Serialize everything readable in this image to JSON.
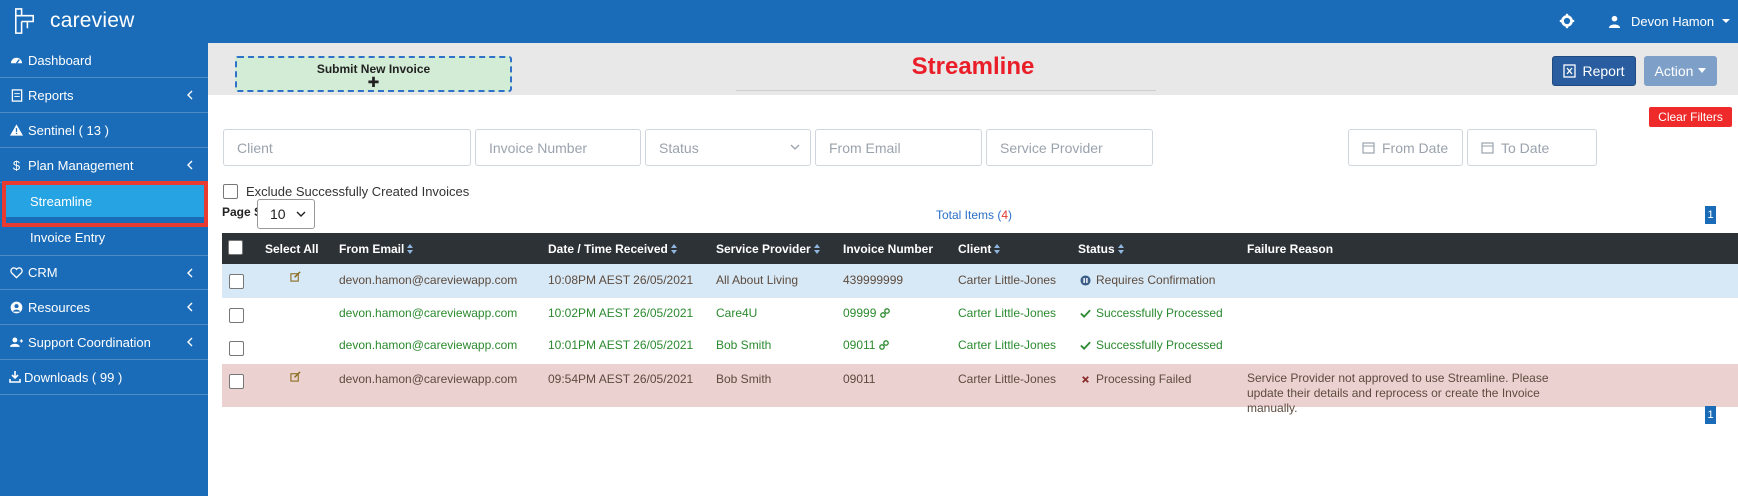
{
  "app": {
    "name": "careview",
    "user_name": "Devon Hamon"
  },
  "sidebar": {
    "items": [
      {
        "label": "Dashboard"
      },
      {
        "label": "Reports"
      },
      {
        "label": "Sentinel ( 13 )"
      },
      {
        "label": "Plan Management"
      },
      {
        "label": "Streamline"
      },
      {
        "label": "Invoice Entry"
      },
      {
        "label": "CRM"
      },
      {
        "label": "Resources"
      },
      {
        "label": "Support Coordination"
      },
      {
        "label": "Downloads ( 99 )"
      }
    ]
  },
  "header": {
    "submit_label": "Submit New Invoice",
    "submit_plus": "✚",
    "title": "Streamline",
    "report_label": "Report",
    "action_label": "Action"
  },
  "filters": {
    "clear_label": "Clear Filters",
    "client_placeholder": "Client",
    "invoice_number_placeholder": "Invoice Number",
    "status_placeholder": "Status",
    "from_email_placeholder": "From Email",
    "service_provider_placeholder": "Service Provider",
    "from_date_placeholder": "From Date",
    "to_date_placeholder": "To Date",
    "exclude_label": "Exclude Successfully Created Invoices"
  },
  "paging": {
    "page_size_label": "Page Size:",
    "page_size_value": "10",
    "total_prefix": "Total Items (",
    "total_count": "4",
    "total_suffix": ")",
    "current_page": "1"
  },
  "table": {
    "columns": [
      "Select All",
      "From Email",
      "Date / Time Received",
      "Service Provider",
      "Invoice Number",
      "Client",
      "Status",
      "Failure Reason"
    ],
    "rows": [
      {
        "email": "devon.hamon@careviewapp.com",
        "received": "10:08PM AEST 26/05/2021",
        "provider": "All About Living",
        "invoice": "439999999",
        "client": "Carter Little-Jones",
        "status": "Requires Confirmation",
        "failure": ""
      },
      {
        "email": "devon.hamon@careviewapp.com",
        "received": "10:02PM AEST 26/05/2021",
        "provider": "Care4U",
        "invoice": "09999",
        "client": "Carter Little-Jones",
        "status": "Successfully Processed",
        "failure": ""
      },
      {
        "email": "devon.hamon@careviewapp.com",
        "received": "10:01PM AEST 26/05/2021",
        "provider": "Bob Smith",
        "invoice": "09011",
        "client": "Carter Little-Jones",
        "status": "Successfully Processed",
        "failure": ""
      },
      {
        "email": "devon.hamon@careviewapp.com",
        "received": "09:54PM AEST 26/05/2021",
        "provider": "Bob Smith",
        "invoice": "09011",
        "client": "Carter Little-Jones",
        "status": "Processing Failed",
        "failure": "Service Provider not approved to use Streamline. Please update their details and reprocess or create the Invoice manually."
      }
    ]
  },
  "colors": {
    "brand_blue": "#1b6cb8",
    "active_blue": "#26a3e2",
    "title_red": "#ea1e28",
    "success_green": "#2b8a2f",
    "failed_row": "#ecd1d1",
    "pending_row": "#d7e9f6"
  }
}
